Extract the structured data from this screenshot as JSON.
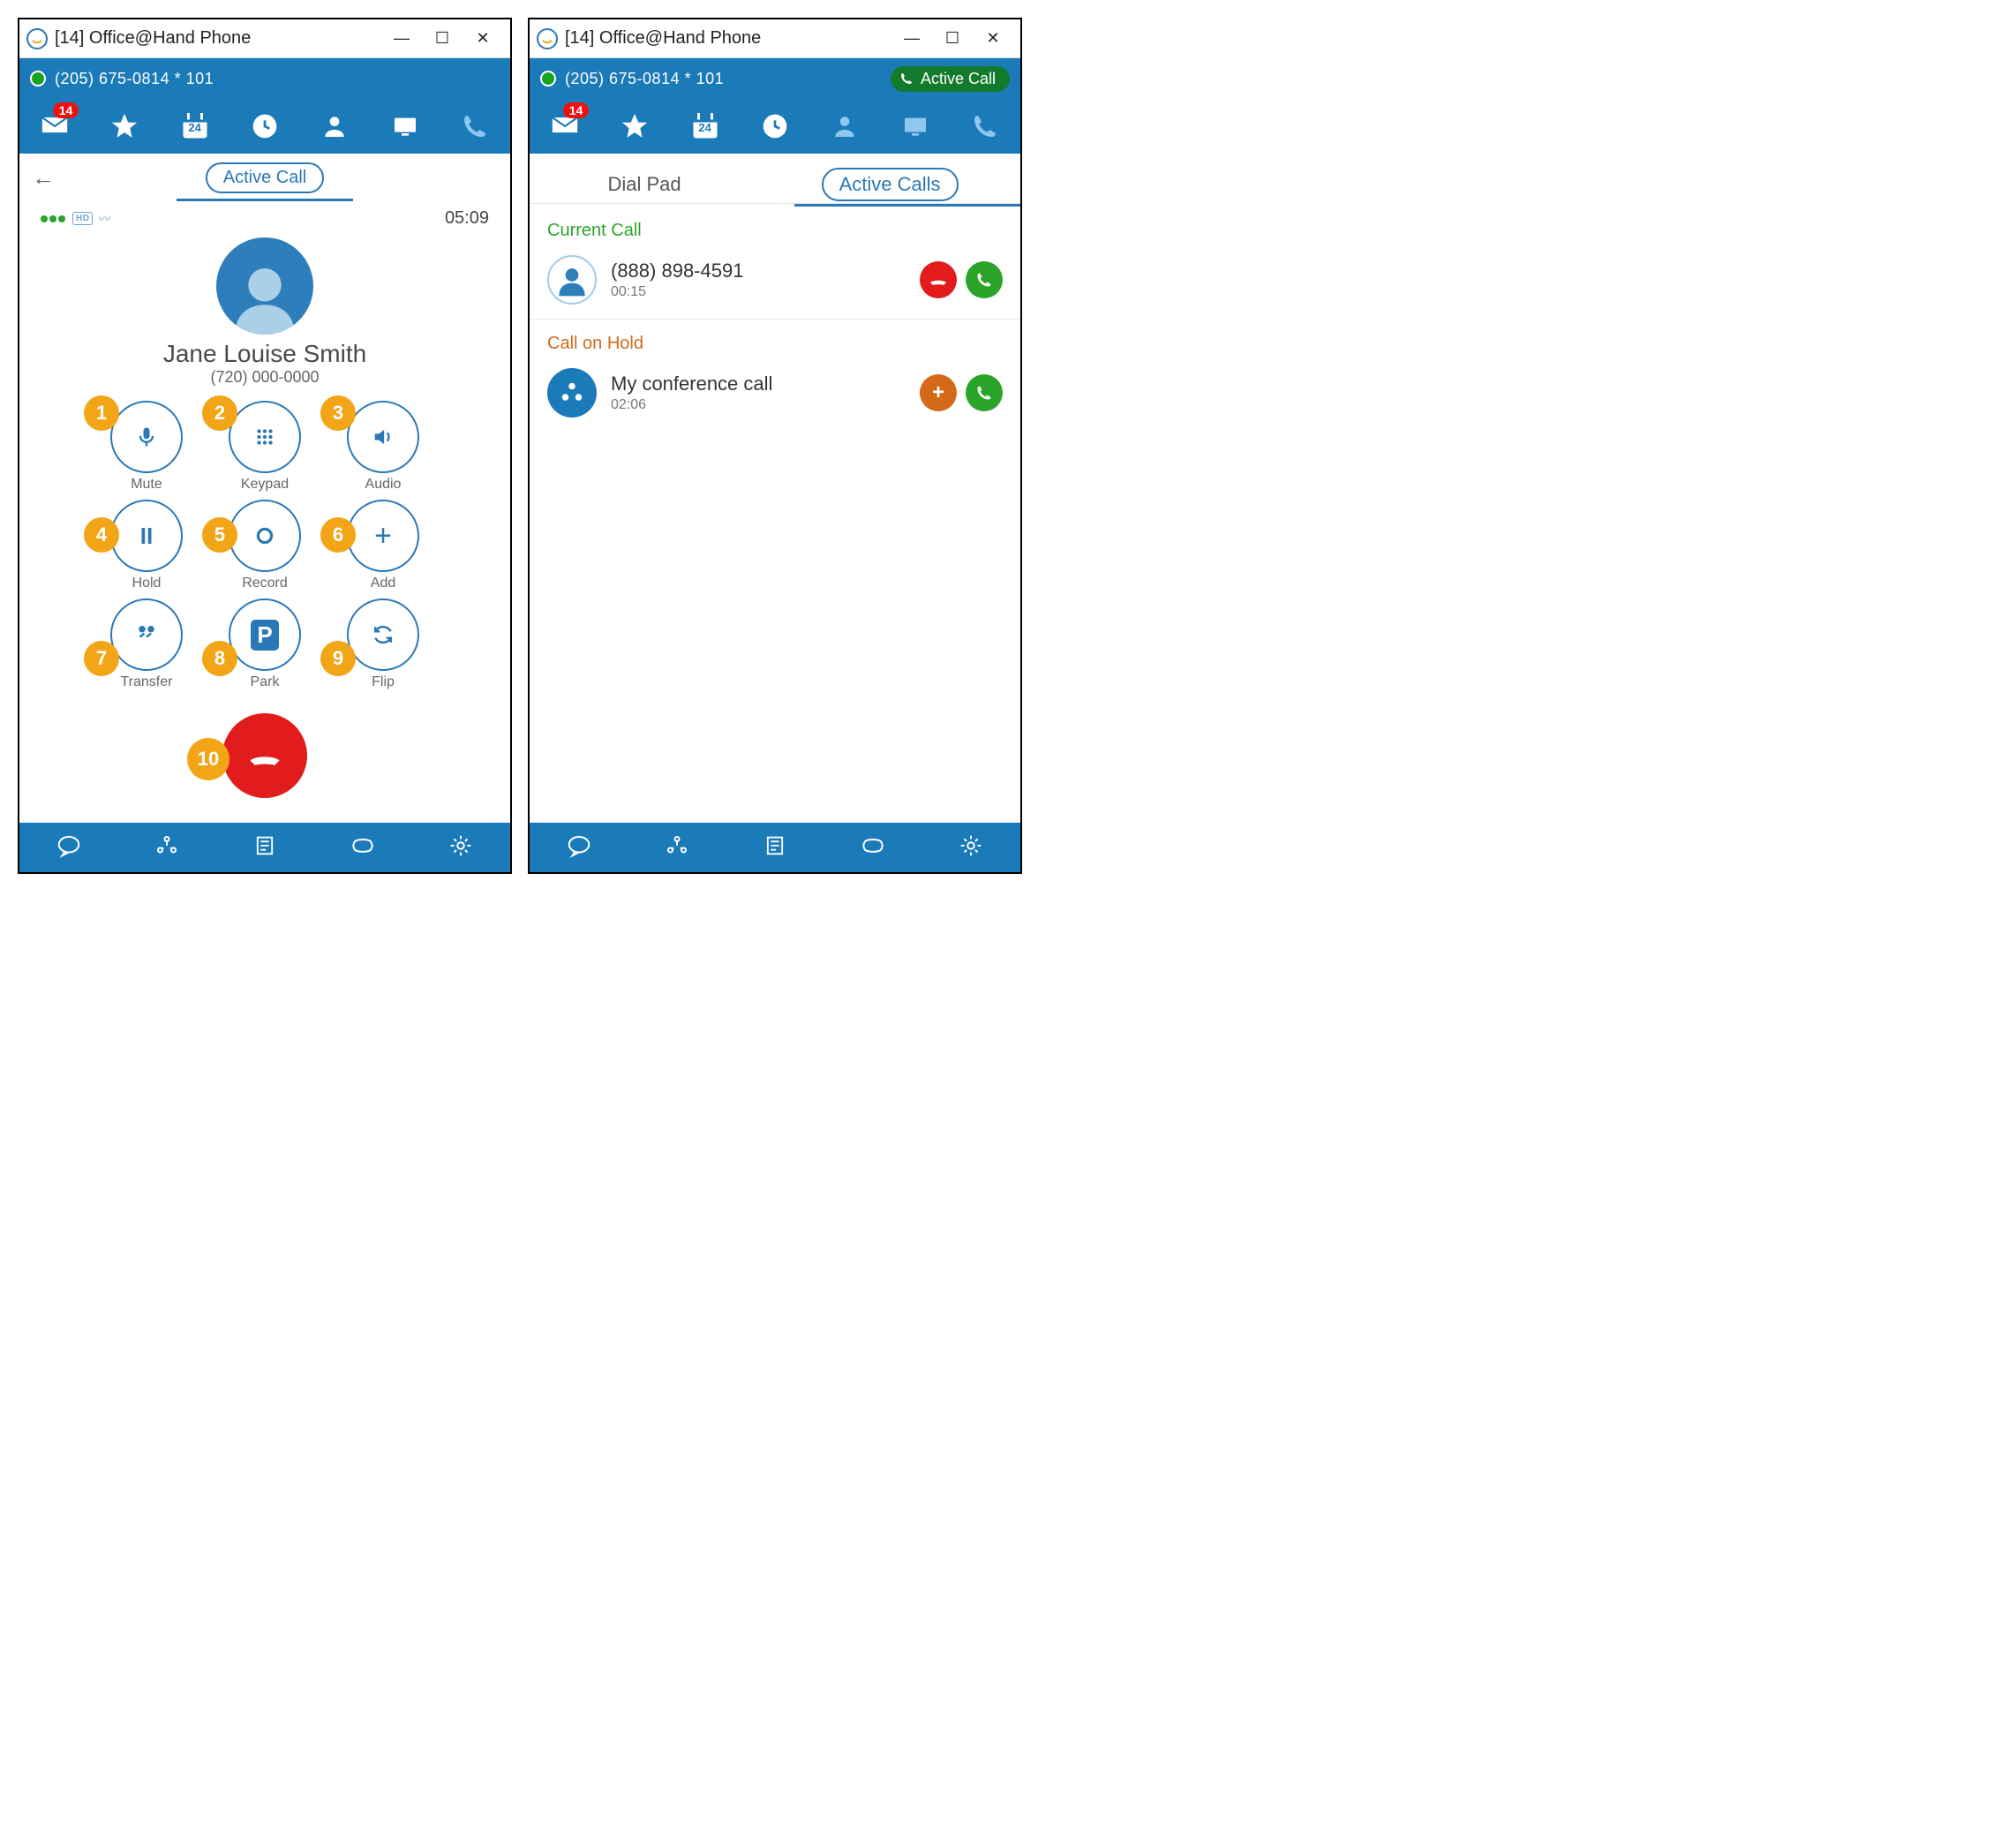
{
  "colors": {
    "brand": "#1b7ab8",
    "accent": "#2a78b6",
    "badge_red": "#e11",
    "end_red": "#e21c1c",
    "annot_orange": "#f2a516",
    "active_green": "#117a2b",
    "ok_green": "#2aa52a",
    "hold_orange": "#d46a19"
  },
  "windows": {
    "left": {
      "title": "[14] Office@Hand Phone",
      "status_line": "(205) 675-0814 * 101",
      "nav_badge": "14",
      "calendar_day": "24",
      "header_tab_label": "Active Call",
      "hd_label": "HD",
      "timer": "05:09",
      "caller_name": "Jane Louise Smith",
      "caller_number": "(720) 000-0000",
      "buttons": [
        {
          "num": "1",
          "label": "Mute"
        },
        {
          "num": "2",
          "label": "Keypad"
        },
        {
          "num": "3",
          "label": "Audio"
        },
        {
          "num": "4",
          "label": "Hold"
        },
        {
          "num": "5",
          "label": "Record"
        },
        {
          "num": "6",
          "label": "Add"
        },
        {
          "num": "7",
          "label": "Transfer"
        },
        {
          "num": "8",
          "label": "Park"
        },
        {
          "num": "9",
          "label": "Flip"
        }
      ],
      "end_num": "10"
    },
    "right": {
      "title": "[14] Office@Hand Phone",
      "status_line": "(205) 675-0814 * 101",
      "active_call_pill": "Active Call",
      "nav_badge": "14",
      "calendar_day": "24",
      "tabs": {
        "dialpad": "Dial Pad",
        "active": "Active Calls"
      },
      "sections": {
        "current": {
          "title": "Current Call",
          "number": "(888) 898-4591",
          "duration": "00:15"
        },
        "hold": {
          "title": "Call on Hold",
          "number": "My conference call",
          "duration": "02:06",
          "plus_label": "+"
        }
      }
    }
  }
}
